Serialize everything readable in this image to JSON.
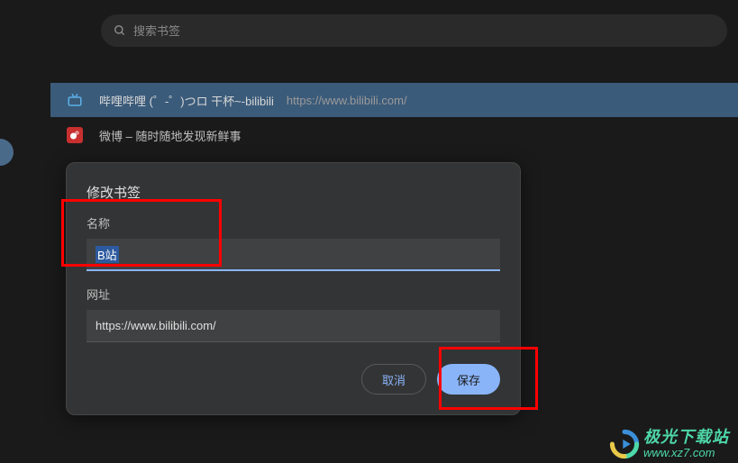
{
  "search": {
    "placeholder": "搜索书签"
  },
  "bookmarks": [
    {
      "title": "哔哩哔哩 (゜-゜)つロ 干杯~-bilibili",
      "url": "https://www.bilibili.com/",
      "icon": "bilibili-tv-icon"
    },
    {
      "title": "微博 – 随时随地发现新鲜事",
      "url": "",
      "icon": "weibo-icon"
    }
  ],
  "dialog": {
    "title": "修改书签",
    "name_label": "名称",
    "name_value": "B站",
    "url_label": "网址",
    "url_value": "https://www.bilibili.com/",
    "cancel_label": "取消",
    "save_label": "保存"
  },
  "watermark": {
    "title": "极光下载站",
    "url": "www.xz7.com"
  }
}
